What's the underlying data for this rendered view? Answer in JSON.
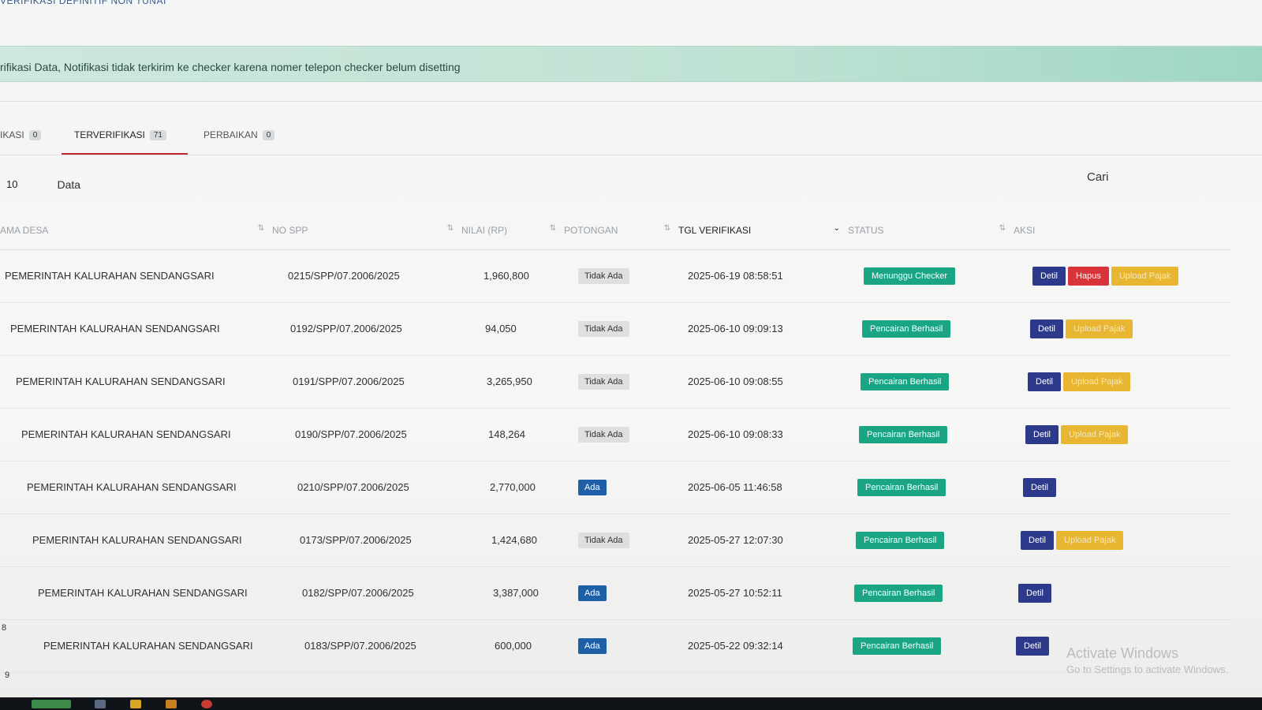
{
  "page": {
    "title": "VERIFIKASI DEFINITIF NON TUNAI"
  },
  "alert": {
    "text": "rifikasi Data, Notifikasi tidak terkirim ke checker karena nomer telepon checker belum disetting"
  },
  "tabs": [
    {
      "label": "IKASI",
      "count": "0"
    },
    {
      "label": "TERVERIFIKASI",
      "count": "71"
    },
    {
      "label": "PERBAIKAN",
      "count": "0"
    }
  ],
  "length": {
    "value": "10",
    "label": "Data"
  },
  "search": {
    "label": "Cari"
  },
  "table": {
    "headers": [
      "AMA DESA",
      "NO SPP",
      "NILAI (RP)",
      "POTONGAN",
      "TGL VERIFIKASI",
      "STATUS",
      "AKSI"
    ],
    "rows": [
      {
        "desa": "PEMERINTAH KALURAHAN SENDANGSARI",
        "spp": "0215/SPP/07.2006/2025",
        "nilai": "1,960,800",
        "potongan": "Tidak Ada",
        "tgl": "2025-06-19 08:58:51",
        "status": "Menunggu Checker",
        "actions": [
          "Detil",
          "Hapus",
          "Upload Pajak"
        ]
      },
      {
        "desa": "PEMERINTAH KALURAHAN SENDANGSARI",
        "spp": "0192/SPP/07.2006/2025",
        "nilai": "94,050",
        "potongan": "Tidak Ada",
        "tgl": "2025-06-10 09:09:13",
        "status": "Pencairan Berhasil",
        "actions": [
          "Detil",
          "Upload Pajak"
        ]
      },
      {
        "desa": "PEMERINTAH KALURAHAN SENDANGSARI",
        "spp": "0191/SPP/07.2006/2025",
        "nilai": "3,265,950",
        "potongan": "Tidak Ada",
        "tgl": "2025-06-10 09:08:55",
        "status": "Pencairan Berhasil",
        "actions": [
          "Detil",
          "Upload Pajak"
        ]
      },
      {
        "desa": "PEMERINTAH KALURAHAN SENDANGSARI",
        "spp": "0190/SPP/07.2006/2025",
        "nilai": "148,264",
        "potongan": "Tidak Ada",
        "tgl": "2025-06-10 09:08:33",
        "status": "Pencairan Berhasil",
        "actions": [
          "Detil",
          "Upload Pajak"
        ]
      },
      {
        "desa": "PEMERINTAH KALURAHAN SENDANGSARI",
        "spp": "0210/SPP/07.2006/2025",
        "nilai": "2,770,000",
        "potongan": "Ada",
        "tgl": "2025-06-05 11:46:58",
        "status": "Pencairan Berhasil",
        "actions": [
          "Detil"
        ]
      },
      {
        "desa": "PEMERINTAH KALURAHAN SENDANGSARI",
        "spp": "0173/SPP/07.2006/2025",
        "nilai": "1,424,680",
        "potongan": "Tidak Ada",
        "tgl": "2025-05-27 12:07:30",
        "status": "Pencairan Berhasil",
        "actions": [
          "Detil",
          "Upload Pajak"
        ]
      },
      {
        "desa": "PEMERINTAH KALURAHAN SENDANGSARI",
        "spp": "0182/SPP/07.2006/2025",
        "nilai": "3,387,000",
        "potongan": "Ada",
        "tgl": "2025-05-27 10:52:11",
        "status": "Pencairan Berhasil",
        "actions": [
          "Detil"
        ]
      },
      {
        "desa": "PEMERINTAH KALURAHAN SENDANGSARI",
        "spp": "0183/SPP/07.2006/2025",
        "nilai": "600,000",
        "potongan": "Ada",
        "tgl": "2025-05-22 09:32:14",
        "status": "Pencairan Berhasil",
        "actions": [
          "Detil"
        ]
      }
    ]
  },
  "row_numbers": [
    "8",
    "9"
  ],
  "watermark": {
    "line1": "Activate Windows",
    "line2": "Go to Settings to activate Windows."
  },
  "colors": {
    "accent_tab": "#c0272d",
    "status_green": "#1aa585",
    "detil_blue": "#2d3a8c",
    "hapus_red": "#d9343a",
    "pajak_yellow": "#e8b630",
    "ada_blue": "#1f5fa8"
  }
}
